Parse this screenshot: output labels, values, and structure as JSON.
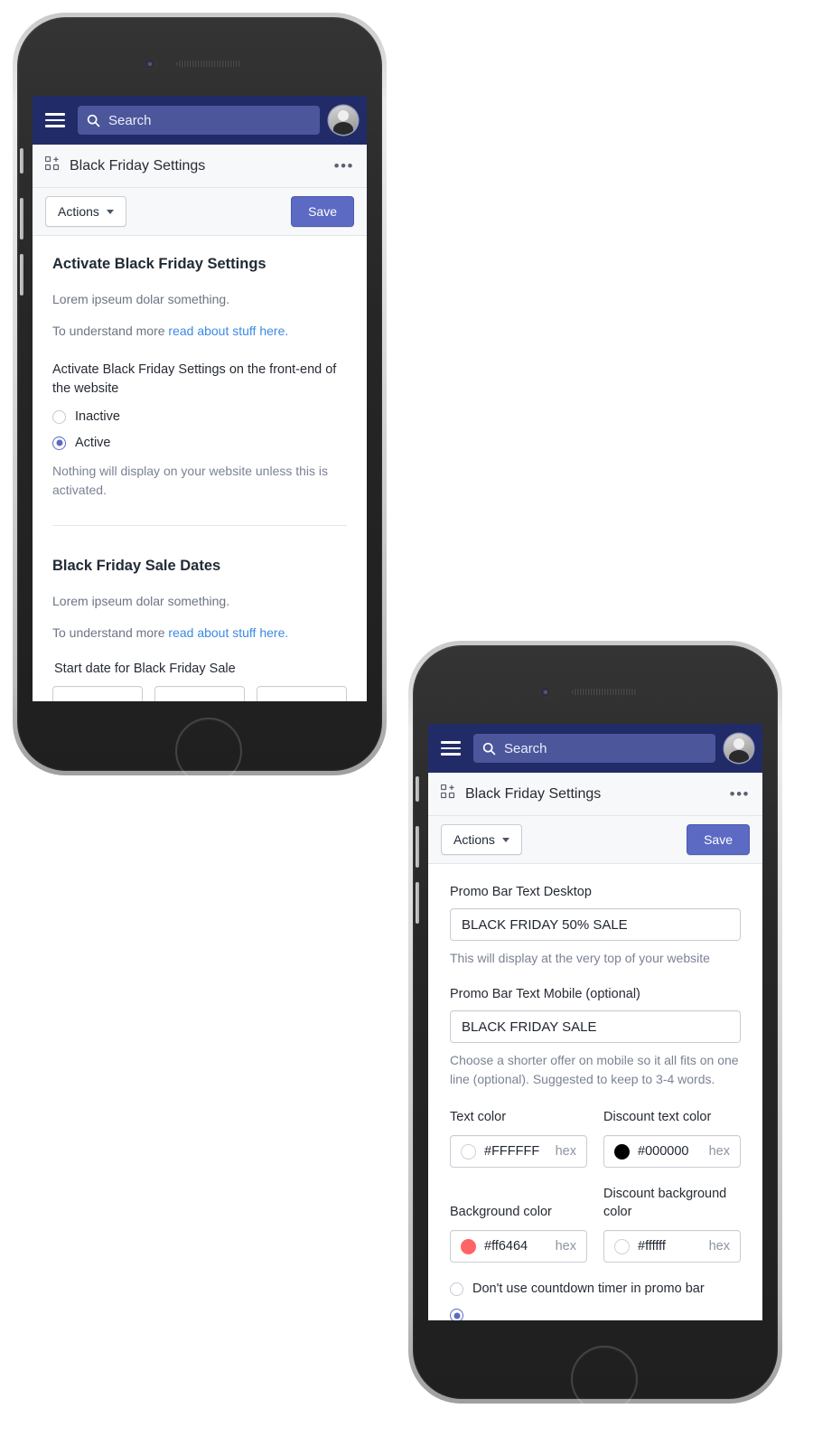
{
  "topbar": {
    "menu_icon": "hamburger-menu-icon",
    "search_placeholder": "Search",
    "search_icon": "search-icon",
    "avatar": "user-avatar",
    "background_color": "#212b68",
    "search_field_color": "#4b569b"
  },
  "pagebar": {
    "app_icon": "apps-grid-icon",
    "title": "Black Friday Settings",
    "more_label": "•••"
  },
  "actionbar": {
    "actions_label": "Actions",
    "save_label": "Save",
    "save_color": "#5c6ac4"
  },
  "phone_one": {
    "sections": [
      {
        "heading": "Activate Black Friday Settings",
        "lorem": "Lorem ipseum dolar something.",
        "understand_prefix": "To understand more ",
        "understand_link": "read about stuff here.",
        "field_label": "Activate Black Friday Settings on the front-end of the website",
        "options": [
          {
            "label": "Inactive",
            "selected": false
          },
          {
            "label": "Active",
            "selected": true
          }
        ],
        "help": "Nothing will display on your website unless this is activated."
      },
      {
        "heading": "Black Friday Sale Dates",
        "lorem": "Lorem ipseum dolar something.",
        "understand_prefix": "To understand more ",
        "understand_link": "read about stuff here.",
        "field_label": "Start date for Black Friday Sale",
        "date_inputs": [
          "",
          "",
          ""
        ]
      }
    ]
  },
  "phone_two": {
    "promo_desktop": {
      "label": "Promo Bar Text Desktop",
      "value": "BLACK FRIDAY 50% SALE",
      "help": "This will display at the very top of your website"
    },
    "promo_mobile": {
      "label": "Promo Bar Text Mobile (optional)",
      "value": "BLACK FRIDAY SALE",
      "help": "Choose a shorter offer on mobile so it all fits on one line (optional). Suggested to keep to 3-4 words."
    },
    "colors": [
      {
        "label": "Text color",
        "value": "#FFFFFF",
        "swatch": "#ffffff",
        "suffix": "hex"
      },
      {
        "label": "Discount text color",
        "value": "#000000",
        "swatch": "#000000",
        "suffix": "hex"
      },
      {
        "label": "Background color",
        "value": "#ff6464",
        "swatch": "#ff6464",
        "suffix": "hex"
      },
      {
        "label": "Discount background color",
        "value": "#ffffff",
        "swatch": "#ffffff",
        "suffix": "hex"
      }
    ],
    "countdown_options": [
      {
        "label": "Don't use countdown timer in promo bar",
        "selected": false
      }
    ]
  }
}
